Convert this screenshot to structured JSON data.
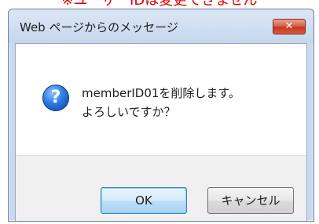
{
  "background_note": "※ユーザーIDは変更できません",
  "dialog": {
    "title": "Web ページからのメッセージ",
    "close_glyph": "✕",
    "icon": "question-icon",
    "icon_glyph": "?",
    "message_line1": "memberID01を削除します。",
    "message_line2": "よろしいですか？",
    "ok_label": "OK",
    "cancel_label": "キャンセル"
  },
  "colors": {
    "note_text": "#e00000",
    "close_button": "#c7361f",
    "frame": "#c9d9ee"
  }
}
